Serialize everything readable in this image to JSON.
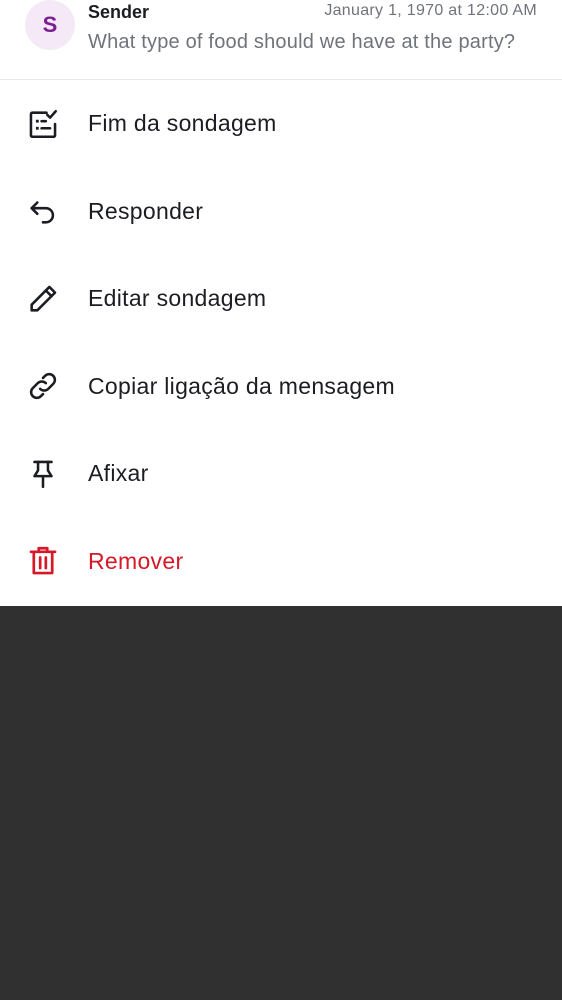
{
  "message": {
    "avatar_initial": "S",
    "sender": "Sender",
    "timestamp": "January 1, 1970 at 12:00 AM",
    "preview": "What type of food should we have at the party?"
  },
  "menu": {
    "items": [
      {
        "label": "Fim da sondagem",
        "icon": "poll-end-icon"
      },
      {
        "label": "Responder",
        "icon": "reply-icon"
      },
      {
        "label": "Editar sondagem",
        "icon": "pencil-icon"
      },
      {
        "label": "Copiar ligação da mensagem",
        "icon": "link-icon"
      },
      {
        "label": "Afixar",
        "icon": "pin-icon"
      },
      {
        "label": "Remover",
        "icon": "trash-icon"
      }
    ]
  },
  "colors": {
    "text_primary": "#1b1d22",
    "text_secondary": "#6f737a",
    "danger": "#d51928",
    "avatar_bg": "#f5e8f7",
    "avatar_fg": "#7b1f92",
    "scrim": "#303030"
  }
}
